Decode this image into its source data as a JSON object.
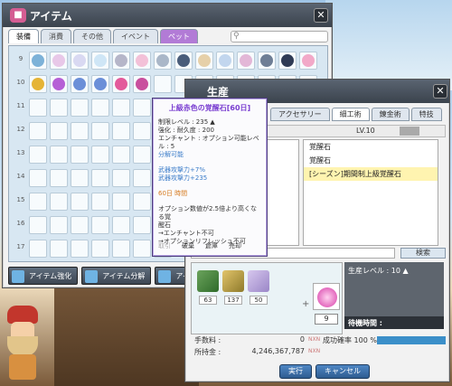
{
  "item_window": {
    "title": "アイテム",
    "tabs": [
      "装備",
      "消費",
      "その他",
      "イベント",
      "ペット"
    ],
    "active_tab": "装備",
    "row_numbers": [
      "9",
      "10",
      "11",
      "12",
      "13",
      "14",
      "15",
      "16",
      "17"
    ],
    "bottom_buttons": [
      "アイテム強化",
      "アイテム分解",
      "アイテム"
    ]
  },
  "tooltip": {
    "title": "上級赤色の覚醒石[60日]",
    "lines": [
      "制限レベル : 235 ▲",
      "強化 : 耐久度 : 200",
      "エンチャント : オプション可能レベル : 5",
      "分解可能"
    ],
    "stats": [
      "武器攻撃力+7%",
      "武器攻撃力+235"
    ],
    "period": "60日 時間",
    "desc": [
      "オプション数値が2.5倍より高くなる覚",
      "醒石",
      "→エンチャント不可",
      "→オプションリフレッシュ不可"
    ],
    "actions": [
      "取引",
      "破棄",
      "倉庫",
      "売却"
    ]
  },
  "craft_window": {
    "title": "生産",
    "tabs": [
      "アクセサリー",
      "細工術",
      "錬金術",
      "特技"
    ],
    "active_tab": "細工術",
    "level": "LV.10",
    "recipes": [
      "覚醒石",
      "覚醒石",
      "[シーズン]期間制上級覚醒石"
    ],
    "search_button": "検索",
    "materials": [
      {
        "qty": "63"
      },
      {
        "qty": "137"
      },
      {
        "qty": "50"
      }
    ],
    "quantity": "9",
    "production_level": "生産レベル : 10 ▲",
    "wait_time": "待機時間 :",
    "fee_label": "手数料 :",
    "fee_value": "0",
    "nx_label": "NXN",
    "success_rate": "成功確率 100 %",
    "success_rate_fraction": 1.0,
    "owned_label": "所持金 :",
    "owned_value": "4,246,367,787",
    "execute_button": "実行",
    "cancel_button": "キャンセル"
  }
}
